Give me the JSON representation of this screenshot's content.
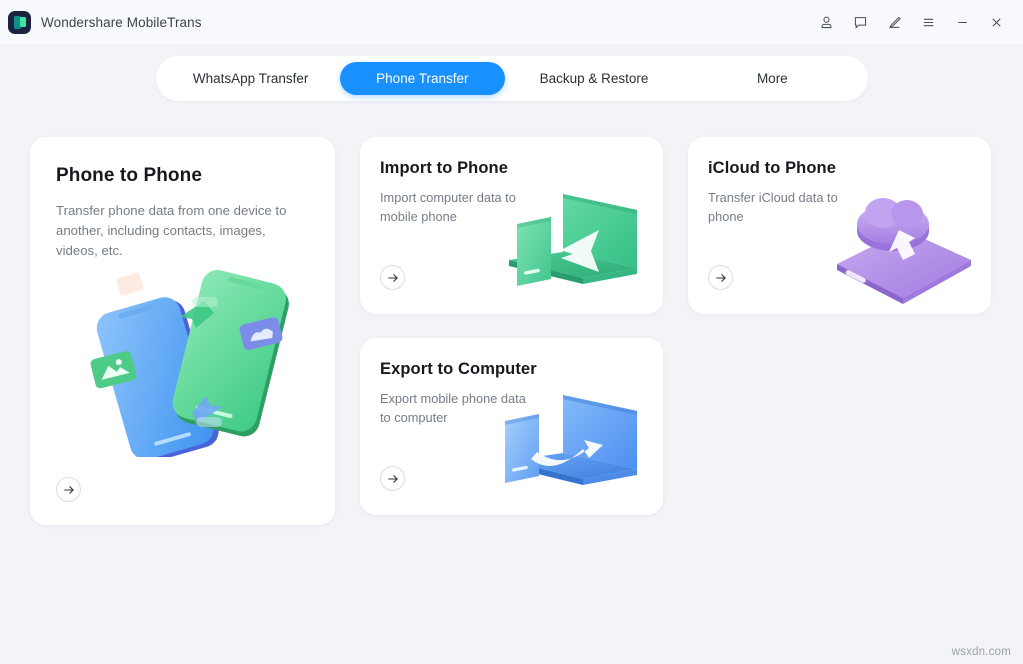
{
  "window": {
    "title": "Wondershare MobileTrans",
    "logo_icon": "mobiletrans-logo-icon",
    "controls": [
      {
        "name": "account-icon",
        "label": "Account"
      },
      {
        "name": "feedback-icon",
        "label": "Feedback"
      },
      {
        "name": "edit-icon",
        "label": "Edit"
      },
      {
        "name": "menu-icon",
        "label": "Menu"
      },
      {
        "name": "minimize-icon",
        "label": "Minimize"
      },
      {
        "name": "close-icon",
        "label": "Close"
      }
    ]
  },
  "tabs": [
    {
      "label": "WhatsApp Transfer",
      "active": false
    },
    {
      "label": "Phone Transfer",
      "active": true
    },
    {
      "label": "Backup & Restore",
      "active": false
    },
    {
      "label": "More",
      "active": false
    }
  ],
  "cards": {
    "phone_to_phone": {
      "title": "Phone to Phone",
      "description": "Transfer phone data from one device to another, including contacts, images, videos, etc.",
      "action_icon": "arrow-right-icon",
      "illustration": "two-phones-transfer-illustration"
    },
    "import_to_phone": {
      "title": "Import to Phone",
      "description": "Import computer data to mobile phone",
      "action_icon": "arrow-right-icon",
      "illustration": "green-laptop-to-phone-illustration"
    },
    "icloud_to_phone": {
      "title": "iCloud to Phone",
      "description": "Transfer iCloud data to phone",
      "action_icon": "arrow-right-icon",
      "illustration": "purple-cloud-to-phone-illustration"
    },
    "export_to_computer": {
      "title": "Export to Computer",
      "description": "Export mobile phone data to computer",
      "action_icon": "arrow-right-icon",
      "illustration": "blue-phone-to-laptop-illustration"
    }
  },
  "watermark": "wsxdn.com",
  "colors": {
    "accent_blue": "#1890ff",
    "page_background": "#f2f4f8",
    "card_background": "#ffffff",
    "title_text": "#16191f",
    "description_text": "#767d88",
    "green_illustration": "#4bd08b",
    "blue_illustration": "#59a5f5",
    "purple_illustration": "#b28ee8"
  }
}
